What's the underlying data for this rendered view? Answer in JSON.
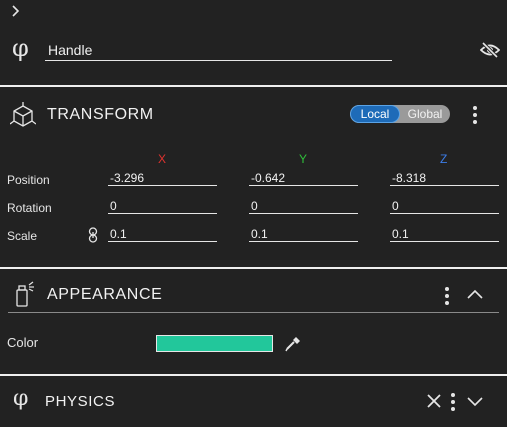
{
  "header": {
    "object_name": "Handle"
  },
  "transform": {
    "title": "TRANSFORM",
    "space_toggle": {
      "local": "Local",
      "global": "Global",
      "selected": "Local"
    },
    "axes": {
      "x": "X",
      "y": "Y",
      "z": "Z"
    },
    "rows": [
      {
        "label": "Position",
        "x": "-3.296",
        "y": "-0.642",
        "z": "-8.318"
      },
      {
        "label": "Rotation",
        "x": "0",
        "y": "0",
        "z": "0"
      },
      {
        "label": "Scale",
        "x": "0.1",
        "y": "0.1",
        "z": "0.1"
      }
    ]
  },
  "appearance": {
    "title": "APPEARANCE",
    "color_label": "Color",
    "color_value": "#22c79b"
  },
  "physics": {
    "title": "PHYSICS"
  },
  "colors": {
    "panel_bg": "#222222",
    "axis_x": "#e0332f",
    "axis_y": "#2fbf3a",
    "axis_z": "#3c7de8",
    "toggle_active": "#1e6bb8"
  }
}
